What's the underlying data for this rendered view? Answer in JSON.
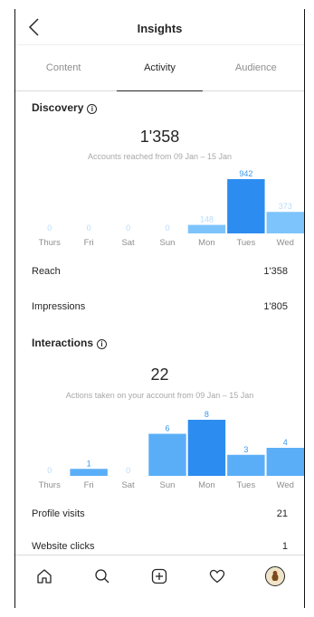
{
  "header": {
    "title": "Insights"
  },
  "tabs": [
    {
      "label": "Content",
      "active": false
    },
    {
      "label": "Activity",
      "active": true
    },
    {
      "label": "Audience",
      "active": false
    }
  ],
  "discovery": {
    "title": "Discovery",
    "total": "1'358",
    "subtitle": "Accounts reached from  09 Jan – 15 Jan",
    "reach_label": "Reach",
    "reach_value": "1'358",
    "impressions_label": "Impressions",
    "impressions_value": "1'805"
  },
  "interactions": {
    "title": "Interactions",
    "total": "22",
    "subtitle": "Actions taken on your account from 09 Jan – 15 Jan",
    "profile_visits_label": "Profile visits",
    "profile_visits_value": "21",
    "website_clicks_label": "Website clicks",
    "website_clicks_value": "1"
  },
  "chart_data": [
    {
      "type": "bar",
      "categories": [
        "Thurs",
        "Fri",
        "Sat",
        "Sun",
        "Mon",
        "Tues",
        "Wed"
      ],
      "values": [
        0,
        0,
        0,
        0,
        148,
        942,
        373
      ],
      "highlight_index": 5
    },
    {
      "type": "bar",
      "categories": [
        "Thurs",
        "Fri",
        "Sat",
        "Sun",
        "Mon",
        "Tues",
        "Wed"
      ],
      "values": [
        0,
        1,
        0,
        6,
        8,
        3,
        4
      ],
      "highlight_index": 4
    }
  ],
  "colors": {
    "bar_light": "#7cc4fb",
    "bar_mid": "#5aaef7",
    "bar_highlight": "#2d8cf0",
    "label_light": "#b8dcfb",
    "label_dark": "#3897f0"
  },
  "nav_icons": [
    "home-icon",
    "search-icon",
    "add-icon",
    "heart-icon",
    "profile-avatar"
  ]
}
